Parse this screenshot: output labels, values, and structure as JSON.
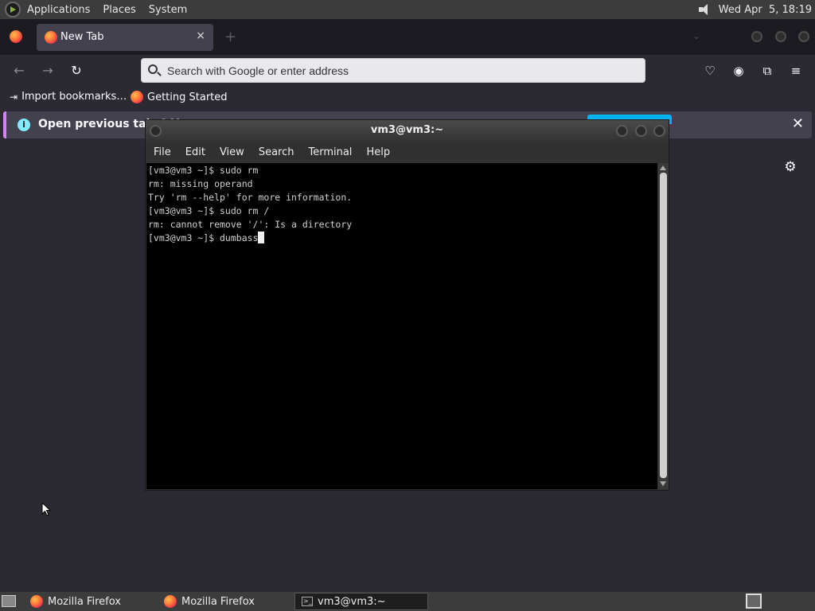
{
  "top_panel": {
    "menus": [
      "Applications",
      "Places",
      "System"
    ],
    "clock": "Wed Apr  5, 18:19"
  },
  "firefox": {
    "tab": {
      "title": "New Tab",
      "close": "×"
    },
    "new_tab": "+",
    "urlbar": {
      "placeholder": "Search with Google or enter address"
    },
    "nav": {
      "back": "←",
      "forward": "→",
      "reload": "↻"
    },
    "toolbar_icons": {
      "pocket": "♡",
      "account": "◉",
      "extensions": "⧉",
      "menu": "≡"
    },
    "bookmarks": [
      {
        "label": "Import bookmarks…",
        "icon": "import-icon"
      },
      {
        "label": "Getting Started",
        "icon": "firefox-icon"
      }
    ],
    "notification": {
      "info": "i",
      "message": "Open previous tabs? Y",
      "close": "✕"
    },
    "settings_gear": "⚙"
  },
  "terminal": {
    "title": "vm3@vm3:~",
    "menus": [
      "File",
      "Edit",
      "View",
      "Search",
      "Terminal",
      "Help"
    ],
    "lines": [
      "[vm3@vm3 ~]$ sudo rm",
      "rm: missing operand",
      "Try 'rm --help' for more information.",
      "[vm3@vm3 ~]$ sudo rm /",
      "rm: cannot remove '/': Is a directory",
      "[vm3@vm3 ~]$ dumbass"
    ]
  },
  "taskbar": {
    "tasks": [
      {
        "label": "Mozilla Firefox",
        "icon": "firefox-icon"
      },
      {
        "label": "Mozilla Firefox",
        "icon": "firefox-icon"
      },
      {
        "label": "vm3@vm3:~",
        "icon": "terminal-icon"
      }
    ]
  }
}
